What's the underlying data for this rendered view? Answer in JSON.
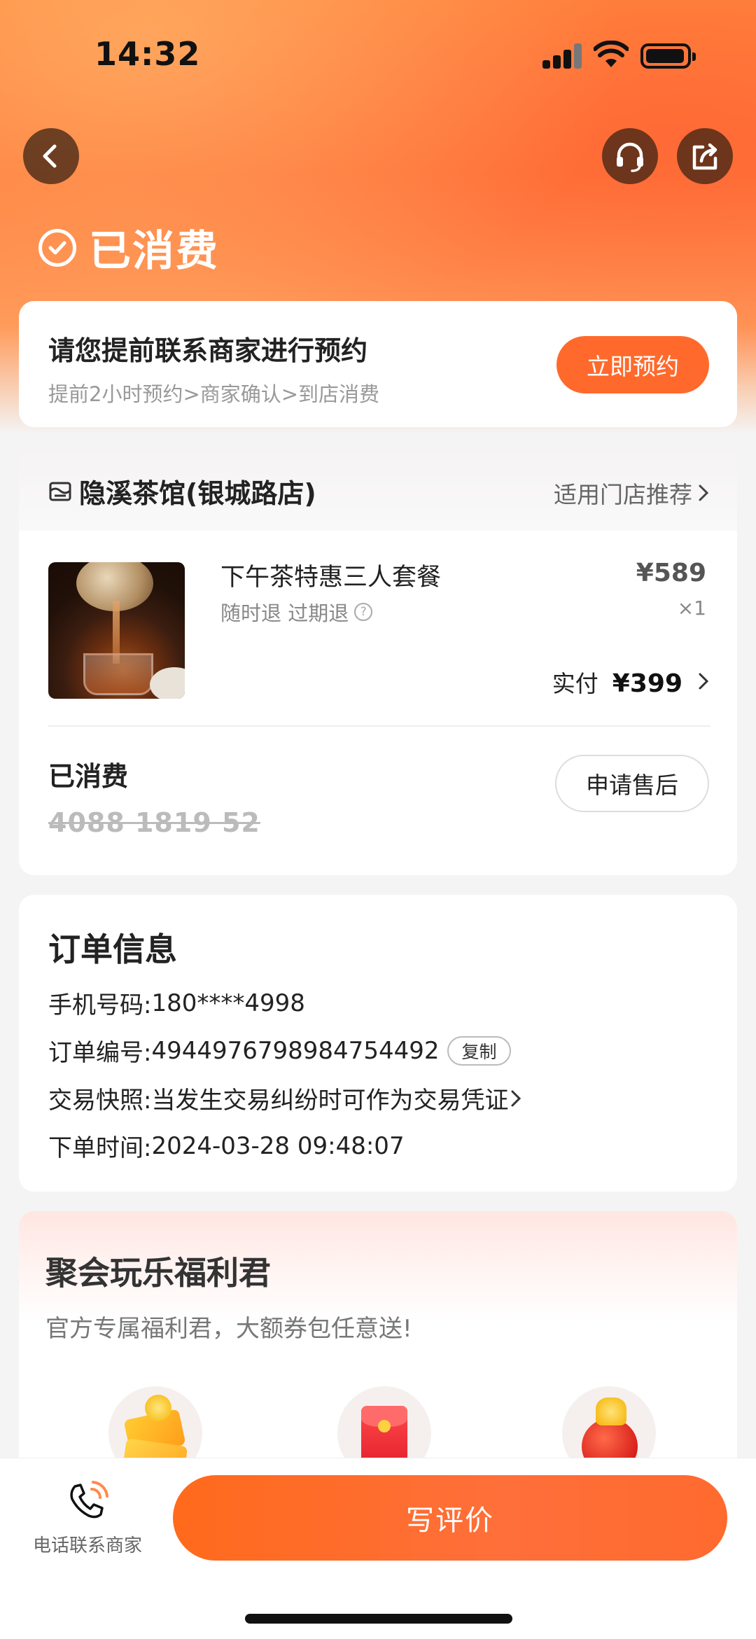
{
  "status_bar": {
    "time": "14:32"
  },
  "header": {
    "status_text": "已消费",
    "icons": [
      "back-icon",
      "headset-icon",
      "share-icon"
    ]
  },
  "booking": {
    "title": "请您提前联系商家进行预约",
    "subtitle": "提前2小时预约>商家确认>到店消费",
    "button": "立即预约"
  },
  "order": {
    "store_name": "隐溪茶馆(银城路店)",
    "store_link": "适用门店推荐",
    "product_name": "下午茶特惠三人套餐",
    "refund_tags": "随时退 过期退",
    "price": "¥589",
    "quantity": "×1",
    "paid_label": "实付",
    "paid_amount": "¥399",
    "consumed_label": "已消费",
    "voucher_code": "4088 1819 52",
    "aftersale_button": "申请售后"
  },
  "order_info": {
    "title": "订单信息",
    "rows": [
      {
        "label": "手机号码:",
        "value": "180****4998"
      },
      {
        "label": "订单编号:",
        "value": "4944976798984754492",
        "action": "复制"
      },
      {
        "label": "交易快照:",
        "value": "当发生交易纠纷时可作为交易凭证"
      },
      {
        "label": "下单时间:",
        "value": "2024-03-28 09:48:07"
      }
    ]
  },
  "benefit": {
    "title": "聚会玩乐福利君",
    "subtitle": "官方专属福利君，大额券包任意送!"
  },
  "bottom_bar": {
    "phone_label": "电话联系商家",
    "review_button": "写评价"
  },
  "colors": {
    "accent": "#ff6a2c",
    "hero_gradient_top": "#ff8a3d"
  }
}
